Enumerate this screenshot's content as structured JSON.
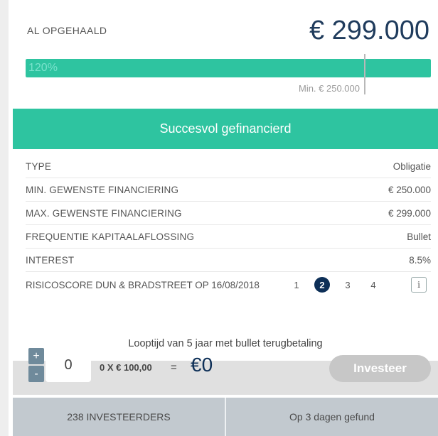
{
  "funding": {
    "raised_label": "AL OPGEHAALD",
    "raised_amount": "€ 299.000",
    "progress_percent_label": "120%",
    "progress_fraction": 1.2,
    "min_label": "Min. € 250.000"
  },
  "status": {
    "banner_text": "Succesvol gefinancierd"
  },
  "details": [
    {
      "label": "TYPE",
      "value": "Obligatie"
    },
    {
      "label": "MIN. GEWENSTE FINANCIERING",
      "value": "€ 250.000"
    },
    {
      "label": "MAX. GEWENSTE FINANCIERING",
      "value": "€ 299.000"
    },
    {
      "label": "FREQUENTIE KAPITAALAFLOSSING",
      "value": "Bullet"
    },
    {
      "label": "INTEREST",
      "value": "8.5%"
    }
  ],
  "risk": {
    "label": "RISICOSCORE DUN & BRADSTREET OP 16/08/2018",
    "scores": [
      "1",
      "2",
      "3",
      "4"
    ],
    "active_score": "2",
    "info_glyph": "i"
  },
  "term_note": "Looptijd van 5 jaar met bullet terugbetaling",
  "invest": {
    "plus": "+",
    "minus": "-",
    "quantity": "0",
    "calculation": "0 X € 100,00",
    "equals": "=",
    "total": "€0",
    "button_label": "Investeer"
  },
  "stats": {
    "investors": "238 INVESTEERDERS",
    "funded_in": "Op 3 dagen gefund"
  },
  "colors": {
    "accent": "#2ec4a0",
    "navy": "#0d2f57",
    "stats_bg": "#c2c9cf"
  }
}
